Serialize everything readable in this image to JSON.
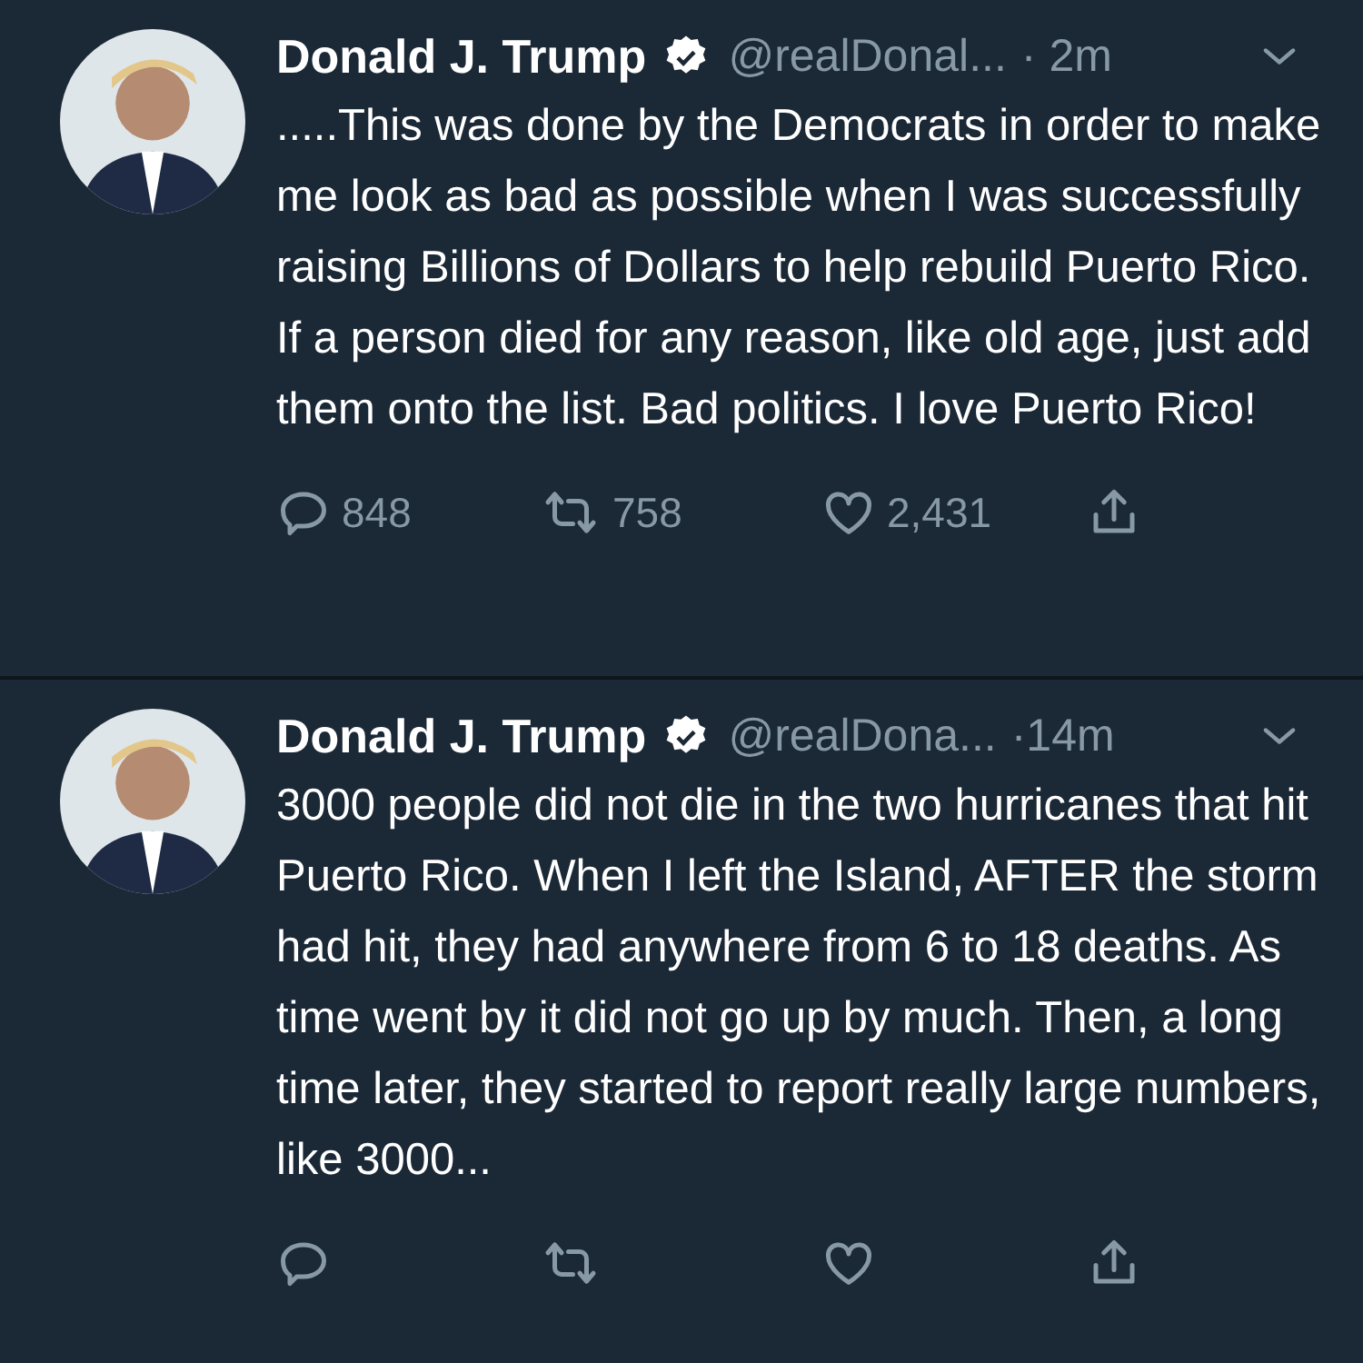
{
  "tweets": [
    {
      "name": "Donald J. Trump",
      "verified": true,
      "handle": "@realDonal...",
      "time": "· 2m",
      "text": ".....This was done by the Democrats in order to make me look as bad as possible when I was successfully raising Billions of Dollars to help rebuild Puerto Rico. If a person died for any reason, like old age, just add them onto the list. Bad politics. I love Puerto Rico!",
      "replies": "848",
      "retweets": "758",
      "likes": "2,431"
    },
    {
      "name": "Donald J. Trump",
      "verified": true,
      "handle": "@realDona...",
      "time": "·14m",
      "text": "3000 people did not die in the two hurricanes that hit Puerto Rico. When I left the Island, AFTER the storm had hit, they had anywhere from 6 to 18 deaths. As time went by it did not go up by much. Then, a long time later, they started to report really large numbers, like 3000..."
    }
  ]
}
